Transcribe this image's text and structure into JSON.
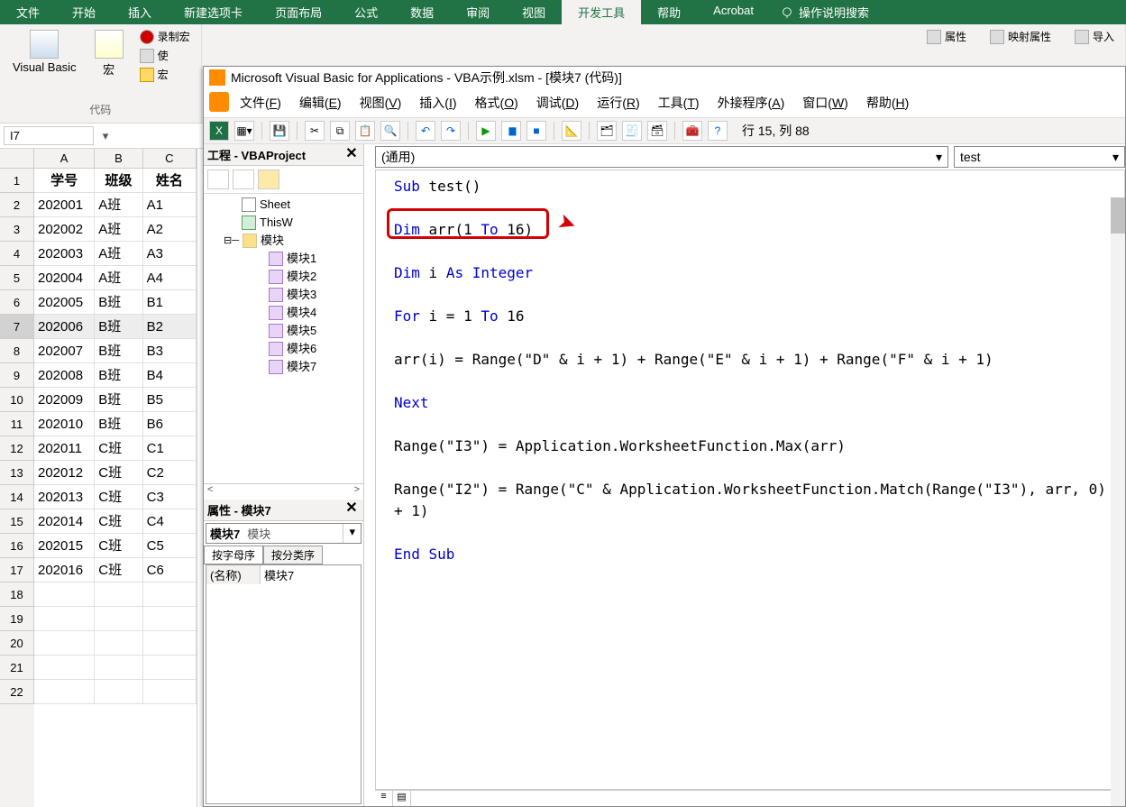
{
  "excel": {
    "tabs": [
      "文件",
      "开始",
      "插入",
      "新建选项卡",
      "页面布局",
      "公式",
      "数据",
      "审阅",
      "视图",
      "开发工具",
      "帮助",
      "Acrobat"
    ],
    "active_tab_index": 9,
    "tell_me": "操作说明搜索",
    "ribbon": {
      "vb": "Visual Basic",
      "macro": "宏",
      "record": "录制宏",
      "rel": "使",
      "sec": "宏",
      "code_group": "代码",
      "props": "属性",
      "map": "映射属性",
      "import": "导入"
    },
    "name_box": "I7"
  },
  "sheet": {
    "cols": [
      "A",
      "B",
      "C"
    ],
    "header_row": [
      "学号",
      "班级",
      "姓名"
    ],
    "rows": [
      [
        "202001",
        "A班",
        "A1"
      ],
      [
        "202002",
        "A班",
        "A2"
      ],
      [
        "202003",
        "A班",
        "A3"
      ],
      [
        "202004",
        "A班",
        "A4"
      ],
      [
        "202005",
        "B班",
        "B1"
      ],
      [
        "202006",
        "B班",
        "B2"
      ],
      [
        "202007",
        "B班",
        "B3"
      ],
      [
        "202008",
        "B班",
        "B4"
      ],
      [
        "202009",
        "B班",
        "B5"
      ],
      [
        "202010",
        "B班",
        "B6"
      ],
      [
        "202011",
        "C班",
        "C1"
      ],
      [
        "202012",
        "C班",
        "C2"
      ],
      [
        "202013",
        "C班",
        "C3"
      ],
      [
        "202014",
        "C班",
        "C4"
      ],
      [
        "202015",
        "C班",
        "C5"
      ],
      [
        "202016",
        "C班",
        "C6"
      ]
    ],
    "selected_row": 7,
    "total_row_heads": 22
  },
  "vbe": {
    "title": "Microsoft Visual Basic for Applications - VBA示例.xlsm - [模块7 (代码)]",
    "menus": [
      {
        "t": "文件",
        "k": "F"
      },
      {
        "t": "编辑",
        "k": "E"
      },
      {
        "t": "视图",
        "k": "V"
      },
      {
        "t": "插入",
        "k": "I"
      },
      {
        "t": "格式",
        "k": "O"
      },
      {
        "t": "调试",
        "k": "D"
      },
      {
        "t": "运行",
        "k": "R"
      },
      {
        "t": "工具",
        "k": "T"
      },
      {
        "t": "外接程序",
        "k": "A"
      },
      {
        "t": "窗口",
        "k": "W"
      },
      {
        "t": "帮助",
        "k": "H"
      }
    ],
    "status": "行 15, 列 88",
    "project_panel_title": "工程 - VBAProject",
    "tree": {
      "sheet": "Sheet",
      "thisw": "ThisW",
      "folder": "模块",
      "modules": [
        "模块1",
        "模块2",
        "模块3",
        "模块4",
        "模块5",
        "模块6",
        "模块7"
      ]
    },
    "props_panel_title": "属性 - 模块7",
    "props": {
      "obj_name": "模块7",
      "obj_type": "模块",
      "tab_alpha": "按字母序",
      "tab_cat": "按分类序",
      "row_name_label": "(名称)",
      "row_name_value": "模块7"
    },
    "code_left_dd": "(通用)",
    "code_right_dd": "test",
    "code": {
      "l1": "Sub test()",
      "l2_a": "Dim",
      "l2_b": " arr(1 ",
      "l2_c": "To",
      "l2_d": " 16)",
      "l3_a": "Dim",
      "l3_b": " i ",
      "l3_c": "As Integer",
      "l4_a": "For",
      "l4_b": " i = 1 ",
      "l4_c": "To",
      "l4_d": " 16",
      "l5": "    arr(i) = Range(\"D\" & i + 1) + Range(\"E\" & i + 1) + Range(\"F\" & i + 1)",
      "l6": "Next",
      "l7": "Range(\"I3\") = Application.WorksheetFunction.Max(arr)",
      "l8": "Range(\"I2\") = Range(\"C\" & Application.WorksheetFunction.Match(Range(\"I3\"), arr, 0) + 1)",
      "l9": "End Sub"
    }
  }
}
